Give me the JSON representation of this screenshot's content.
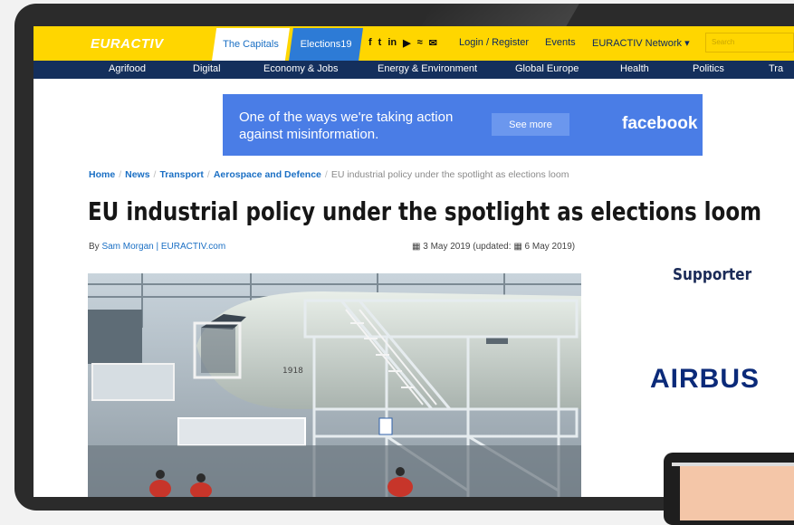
{
  "site": {
    "logo": "EURACTIV",
    "tabs": [
      "The Capitals",
      "Elections19"
    ],
    "social_icons": [
      "facebook-icon",
      "twitter-icon",
      "linkedin-icon",
      "youtube-icon",
      "rss-icon",
      "mail-icon"
    ],
    "social_glyphs": [
      "f",
      "t",
      "in",
      "▶",
      "≈",
      "✉"
    ],
    "top_links": [
      "Login / Register",
      "Events",
      "EURACTIV Network ▾"
    ],
    "search_placeholder": "Search",
    "accent_yellow": "#ffd600",
    "nav_blue": "#142f5c"
  },
  "categories": [
    "Agrifood",
    "Digital",
    "Economy & Jobs",
    "Energy & Environment",
    "Global Europe",
    "Health",
    "Politics",
    "Tra"
  ],
  "ad": {
    "text": "One of the ways we're taking action against misinformation.",
    "button": "See more",
    "brand": "facebook"
  },
  "breadcrumb": {
    "items": [
      "Home",
      "News",
      "Transport",
      "Aerospace and Defence"
    ],
    "current": "EU industrial policy under the spotlight as elections loom"
  },
  "article": {
    "title": "EU industrial policy under the spotlight as elections loom",
    "by": "By",
    "author": "Sam Morgan | EURACTIV.com",
    "date": "3 May 2019 (updated: ",
    "updated": "6 May 2019)",
    "plane_tail_text": "1918"
  },
  "sidebar": {
    "supporter_label": "Supporter",
    "supporter_logo": "AIRBUS"
  }
}
